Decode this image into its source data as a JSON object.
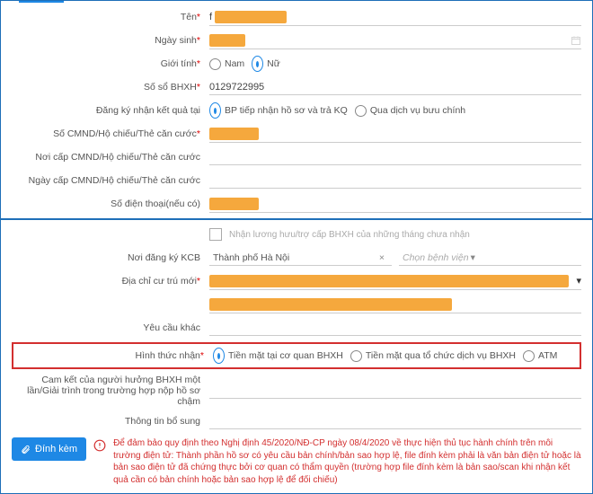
{
  "labels": {
    "ten": "Tên",
    "ngaysinh": "Ngày sinh",
    "gioitinh": "Giới tính",
    "soso": "Số sổ BHXH",
    "dangky": "Đăng ký nhận kết quả tại",
    "cmnd": "Số CMND/Hộ chiếu/Thẻ căn cước",
    "noicap": "Nơi cấp CMND/Hộ chiếu/Thẻ căn cước",
    "ngaycap": "Ngày cấp CMND/Hộ chiếu/Thẻ căn cước",
    "sodt": "Số điện thoại(nếu có)",
    "noidk": "Nơi đăng ký KCB",
    "diachi": "Địa chỉ cư trú mới",
    "yeucau": "Yêu cầu khác",
    "hinhthuc": "Hình thức nhận",
    "camket": "Cam kết của người hưởng BHXH một lần/Giải trình trong trường hợp nộp hồ sơ chậm",
    "thongtin": "Thông tin bổ sung"
  },
  "options": {
    "nam": "Nam",
    "nu": "Nữ",
    "bp": "BP tiếp nhận hồ sơ và trả KQ",
    "buu": "Qua dịch vụ bưu chính",
    "cq": "Tiền mặt tại cơ quan BHXH",
    "tc": "Tiền mặt qua tổ chức dịch vụ BHXH",
    "atm": "ATM"
  },
  "values": {
    "soso": "0129722995",
    "city": "Thành phố Hà Nội",
    "hosp_ph": "Chọn bệnh viện",
    "chk_label": "Nhận lương hưu/trợ cấp BHXH của những tháng chưa nhận",
    "ten_prefix": "f"
  },
  "footer": {
    "attach": "Đính kèm",
    "warn": "Để đảm bảo quy định theo Nghị định 45/2020/NĐ-CP ngày 08/4/2020 về thực hiện thủ tục hành chính trên môi trường điện tử: Thành phần hồ sơ có yêu cầu bản chính/bản sao hợp lệ, file đính kèm phải là văn bản điện tử hoặc là bản sao điện tử đã chứng thực bởi cơ quan có thẩm quyền (trường hợp file đính kèm là bản sao/scan khi nhận kết quả cần có bản chính hoặc bản sao hợp lệ để đối chiếu)"
  }
}
